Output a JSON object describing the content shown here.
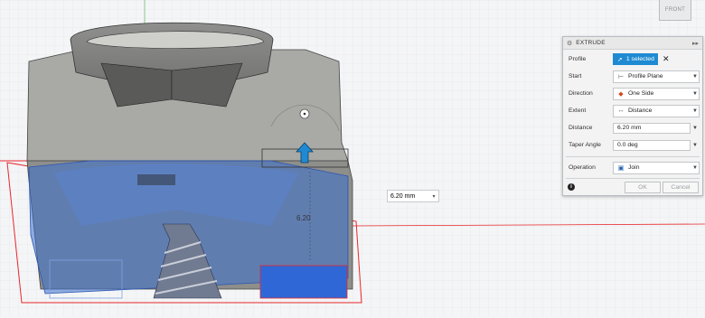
{
  "viewcube": {
    "label": "FRONT"
  },
  "viewport": {
    "dimension_value": "6.20 mm",
    "dimension_arrow": "▾",
    "sketch_dimension_label": "6.20"
  },
  "dialog": {
    "title": "EXTRUDE",
    "header_icon": "gear-icon",
    "expand_icon": "▸▸",
    "rows": {
      "profile": {
        "label": "Profile",
        "value": "1 selected",
        "clear": "✕"
      },
      "start": {
        "label": "Start",
        "value": "Profile Plane"
      },
      "direction": {
        "label": "Direction",
        "value": "One Side"
      },
      "extent": {
        "label": "Extent",
        "value": "Distance"
      },
      "distance": {
        "label": "Distance",
        "value": "6.20 mm"
      },
      "taper": {
        "label": "Taper Angle",
        "value": "0.0 deg"
      },
      "operation": {
        "label": "Operation",
        "value": "Join"
      }
    },
    "ok_label": "OK",
    "cancel_label": "Cancel",
    "info": "i"
  },
  "colors": {
    "accent": "#1f8ad2",
    "sketch_blue": "#3a6fd0",
    "body_gray": "#9a9a98",
    "profile_fill": "#2f68d6",
    "boundary_red": "#e8262b"
  }
}
